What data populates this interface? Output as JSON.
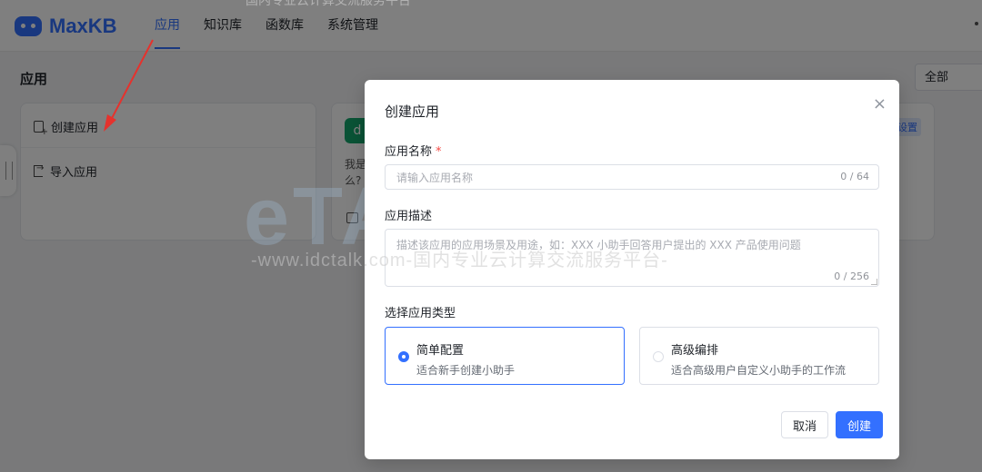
{
  "top_caption": "国内专业云计算交流服务平台",
  "header": {
    "logo": "MaxKB",
    "nav": [
      "应用",
      "知识库",
      "函数库",
      "系统管理"
    ],
    "active": "应用"
  },
  "main": {
    "title": "应用",
    "filter_value": "全部",
    "create_card": {
      "create_label": "创建应用",
      "import_label": "导入应用"
    },
    "app_card": {
      "avatar": "d",
      "desc": "我是\n么?",
      "badge": "设置"
    }
  },
  "watermark": {
    "logo": "eTALK 云说",
    "text": "-www.idctalk.com-国内专业云计算交流服务平台-"
  },
  "dialog": {
    "title": "创建应用",
    "close": "×",
    "name_label": "应用名称",
    "required_mark": "*",
    "name_placeholder": "请输入应用名称",
    "name_value": "",
    "name_counter": "0 / 64",
    "desc_label": "应用描述",
    "desc_placeholder": "描述该应用的应用场景及用途，如：XXX 小助手回答用户提出的 XXX 产品使用问题",
    "desc_value": "",
    "desc_counter": "0 / 256",
    "type_label": "选择应用类型",
    "types": [
      {
        "name": "简单配置",
        "desc": "适合新手创建小助手",
        "selected": true
      },
      {
        "name": "高级编排",
        "desc": "适合高级用户自定义小助手的工作流",
        "selected": false
      }
    ],
    "cancel_label": "取消",
    "create_label": "创建"
  },
  "colors": {
    "primary": "#3370ff",
    "avatar_green": "#14a76c",
    "annotation_arrow": "#e5322d"
  }
}
